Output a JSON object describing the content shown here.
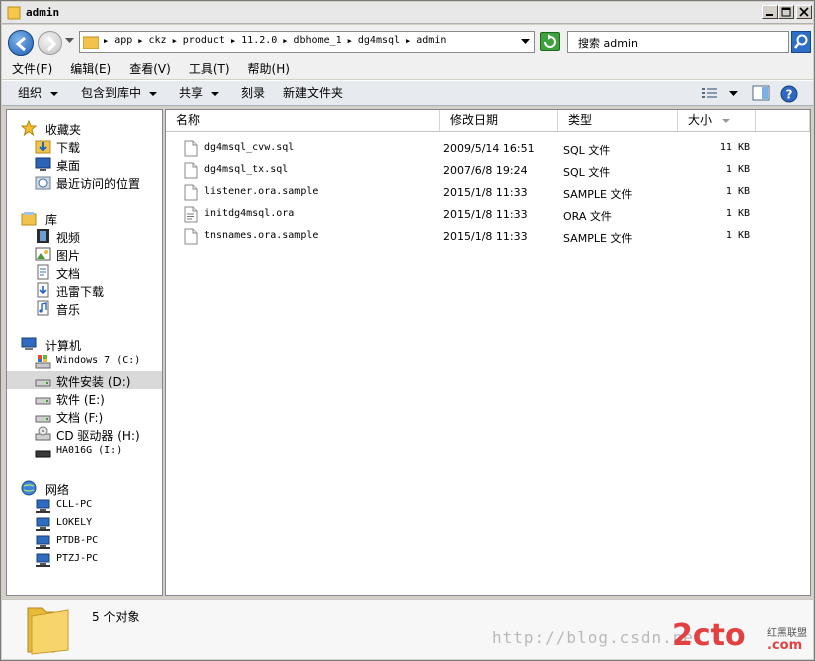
{
  "window": {
    "title": "admin"
  },
  "address": {
    "crumbs": [
      "app",
      "ckz",
      "product",
      "11.2.0",
      "dbhome_1",
      "dg4msql",
      "admin"
    ],
    "search_placeholder": "搜索 admin"
  },
  "menu": [
    {
      "label": "文件(F)"
    },
    {
      "label": "编辑(E)"
    },
    {
      "label": "查看(V)"
    },
    {
      "label": "工具(T)"
    },
    {
      "label": "帮助(H)"
    }
  ],
  "toolbar": {
    "organize": "组织",
    "include_library": "包含到库中",
    "share": "共享",
    "burn": "刻录",
    "new_folder": "新建文件夹"
  },
  "nav": {
    "favorites": {
      "label": "收藏夹",
      "items": [
        "下载",
        "桌面",
        "最近访问的位置"
      ]
    },
    "libraries": {
      "label": "库",
      "items": [
        "视频",
        "图片",
        "文档",
        "迅雷下载",
        "音乐"
      ]
    },
    "computer": {
      "label": "计算机",
      "items": [
        "Windows 7 (C:)",
        "软件安装 (D:)",
        "软件 (E:)",
        "文档 (F:)",
        "CD 驱动器 (H:)",
        "HA016G (I:)"
      ]
    },
    "network": {
      "label": "网络",
      "items": [
        "CLL-PC",
        "LOKELY",
        "PTDB-PC",
        "PTZJ-PC"
      ]
    }
  },
  "columns": {
    "name": "名称",
    "date": "修改日期",
    "type": "类型",
    "size": "大小"
  },
  "files": [
    {
      "name": "dg4msql_cvw.sql",
      "date": "2009/5/14 16:51",
      "type": "SQL 文件",
      "size": "11 KB"
    },
    {
      "name": "dg4msql_tx.sql",
      "date": "2007/6/8 19:24",
      "type": "SQL 文件",
      "size": "1 KB"
    },
    {
      "name": "listener.ora.sample",
      "date": "2015/1/8 11:33",
      "type": "SAMPLE 文件",
      "size": "1 KB"
    },
    {
      "name": "initdg4msql.ora",
      "date": "2015/1/8 11:33",
      "type": "ORA 文件",
      "size": "1 KB"
    },
    {
      "name": "tnsnames.ora.sample",
      "date": "2015/1/8 11:33",
      "type": "SAMPLE 文件",
      "size": "1 KB"
    }
  ],
  "status": {
    "count_text": "5 个对象"
  },
  "watermark": {
    "url": "http://blog.csdn.ne",
    "logo": "2cto",
    "small": "红黑联盟",
    "com": ".com"
  }
}
